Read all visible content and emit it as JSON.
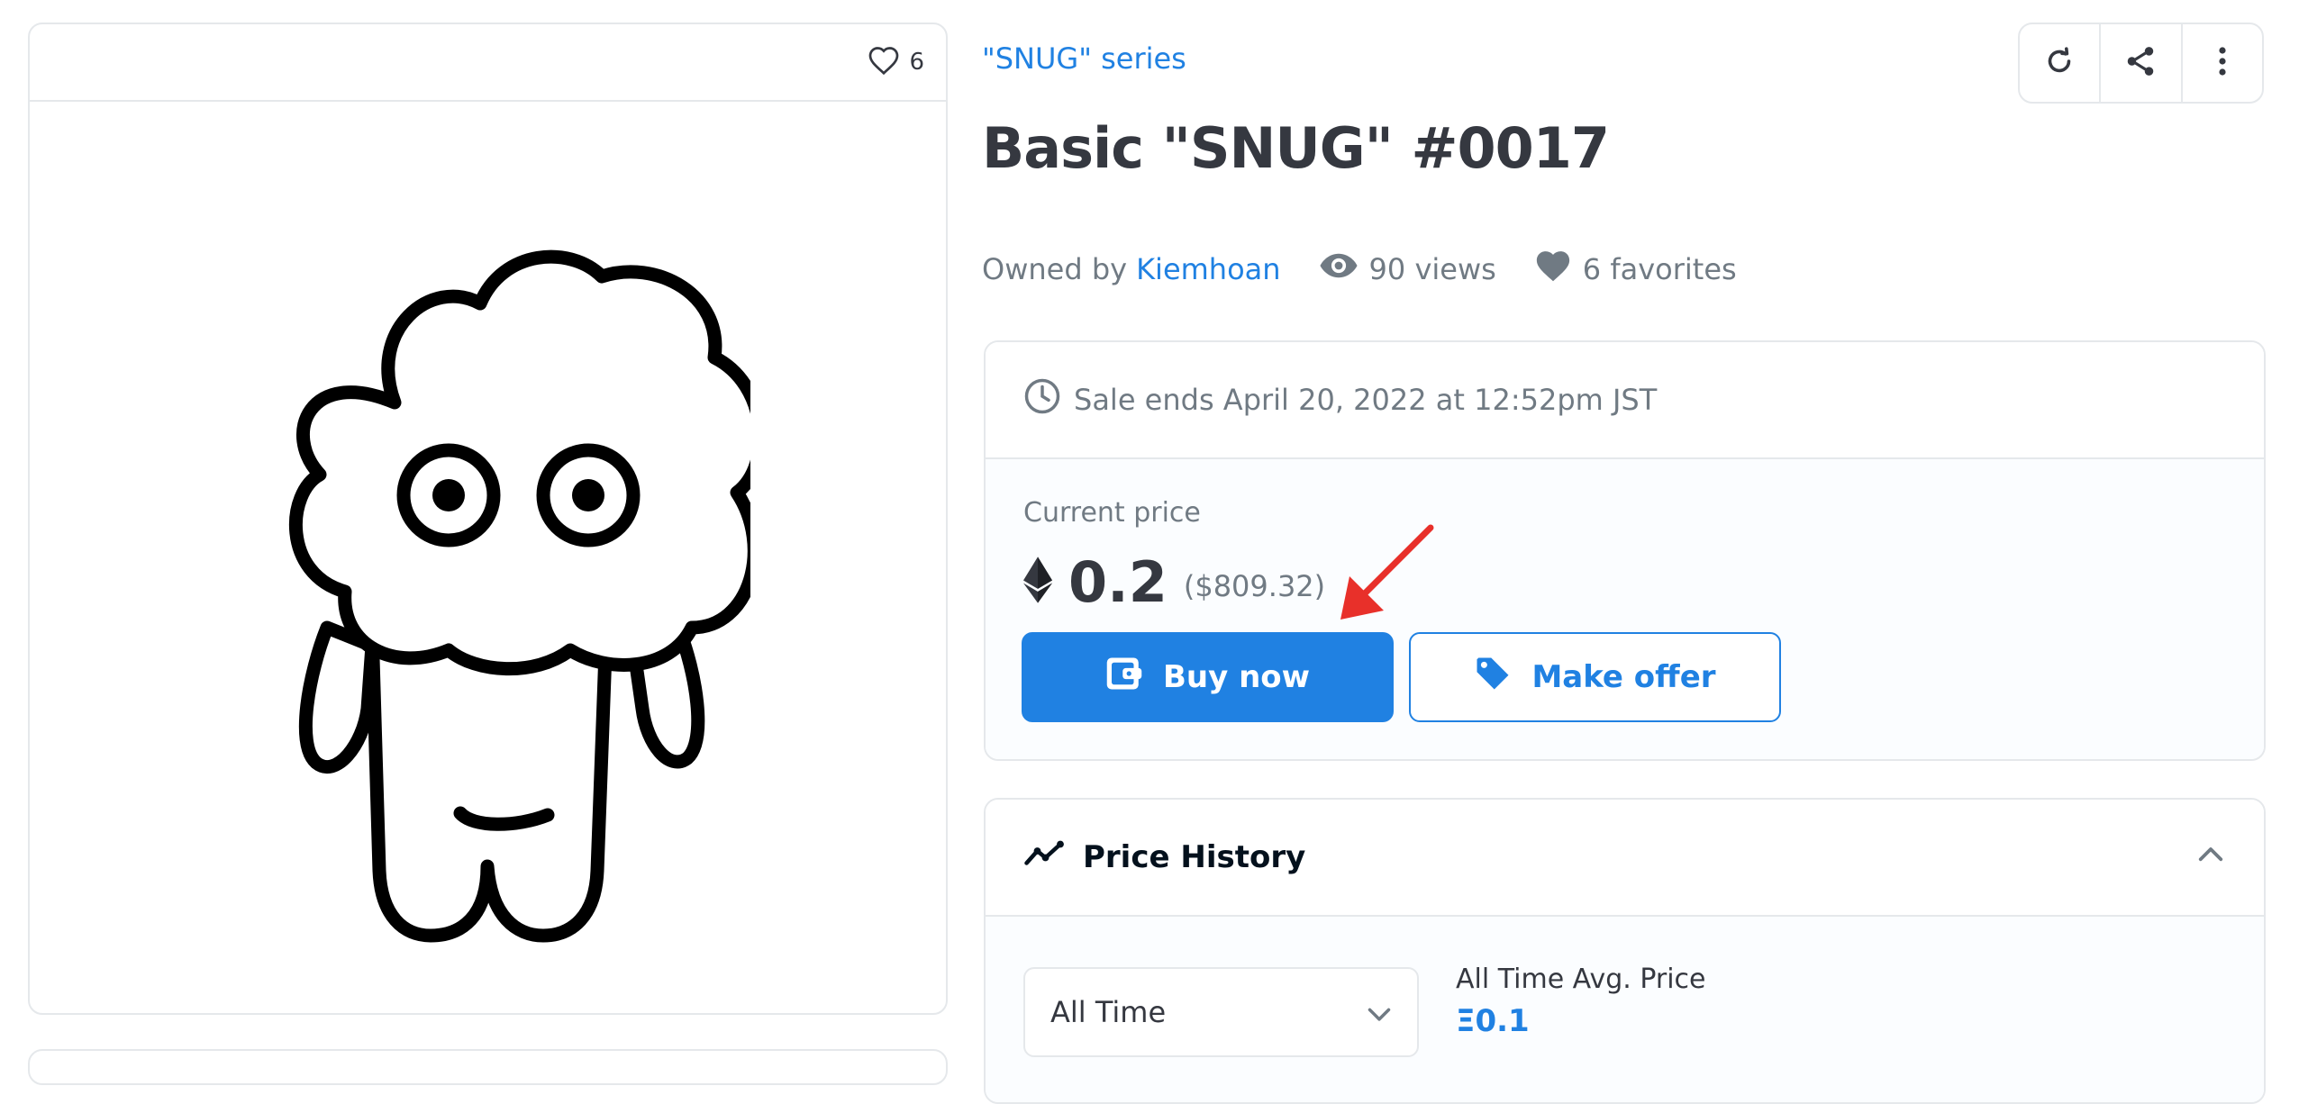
{
  "image_card": {
    "favorite_count": "6"
  },
  "collection": {
    "name": "\"SNUG\" series"
  },
  "item": {
    "title": "Basic \"SNUG\" #0017"
  },
  "owner": {
    "prefix": "Owned by",
    "name": "Kiemhoan"
  },
  "stats": {
    "views": "90 views",
    "favorites": "6 favorites"
  },
  "sale": {
    "ends_text": "Sale ends April 20, 2022 at 12:52pm JST",
    "current_price_label": "Current price",
    "price_eth": "0.2",
    "price_usd": "($809.32)",
    "buy_label": "Buy now",
    "offer_label": "Make offer"
  },
  "price_history": {
    "title": "Price History",
    "range_selected": "All Time",
    "avg_label": "All Time Avg. Price",
    "avg_value": "Ξ0.1"
  },
  "colors": {
    "accent": "#2081e2",
    "border": "#e5e8eb",
    "text_dark": "#353840",
    "text_muted": "#707a83",
    "annotation_arrow": "#e8302a"
  },
  "icons": {
    "favorite": "heart-outline-icon",
    "refresh": "refresh-icon",
    "share": "share-icon",
    "more": "more-vertical-icon",
    "views": "eye-icon",
    "favorites": "heart-filled-icon",
    "clock": "clock-icon",
    "eth": "ethereum-icon",
    "wallet": "wallet-icon",
    "tag": "tag-icon",
    "trend": "trending-icon",
    "collapse": "chevron-up-icon",
    "dropdown": "chevron-down-icon"
  }
}
